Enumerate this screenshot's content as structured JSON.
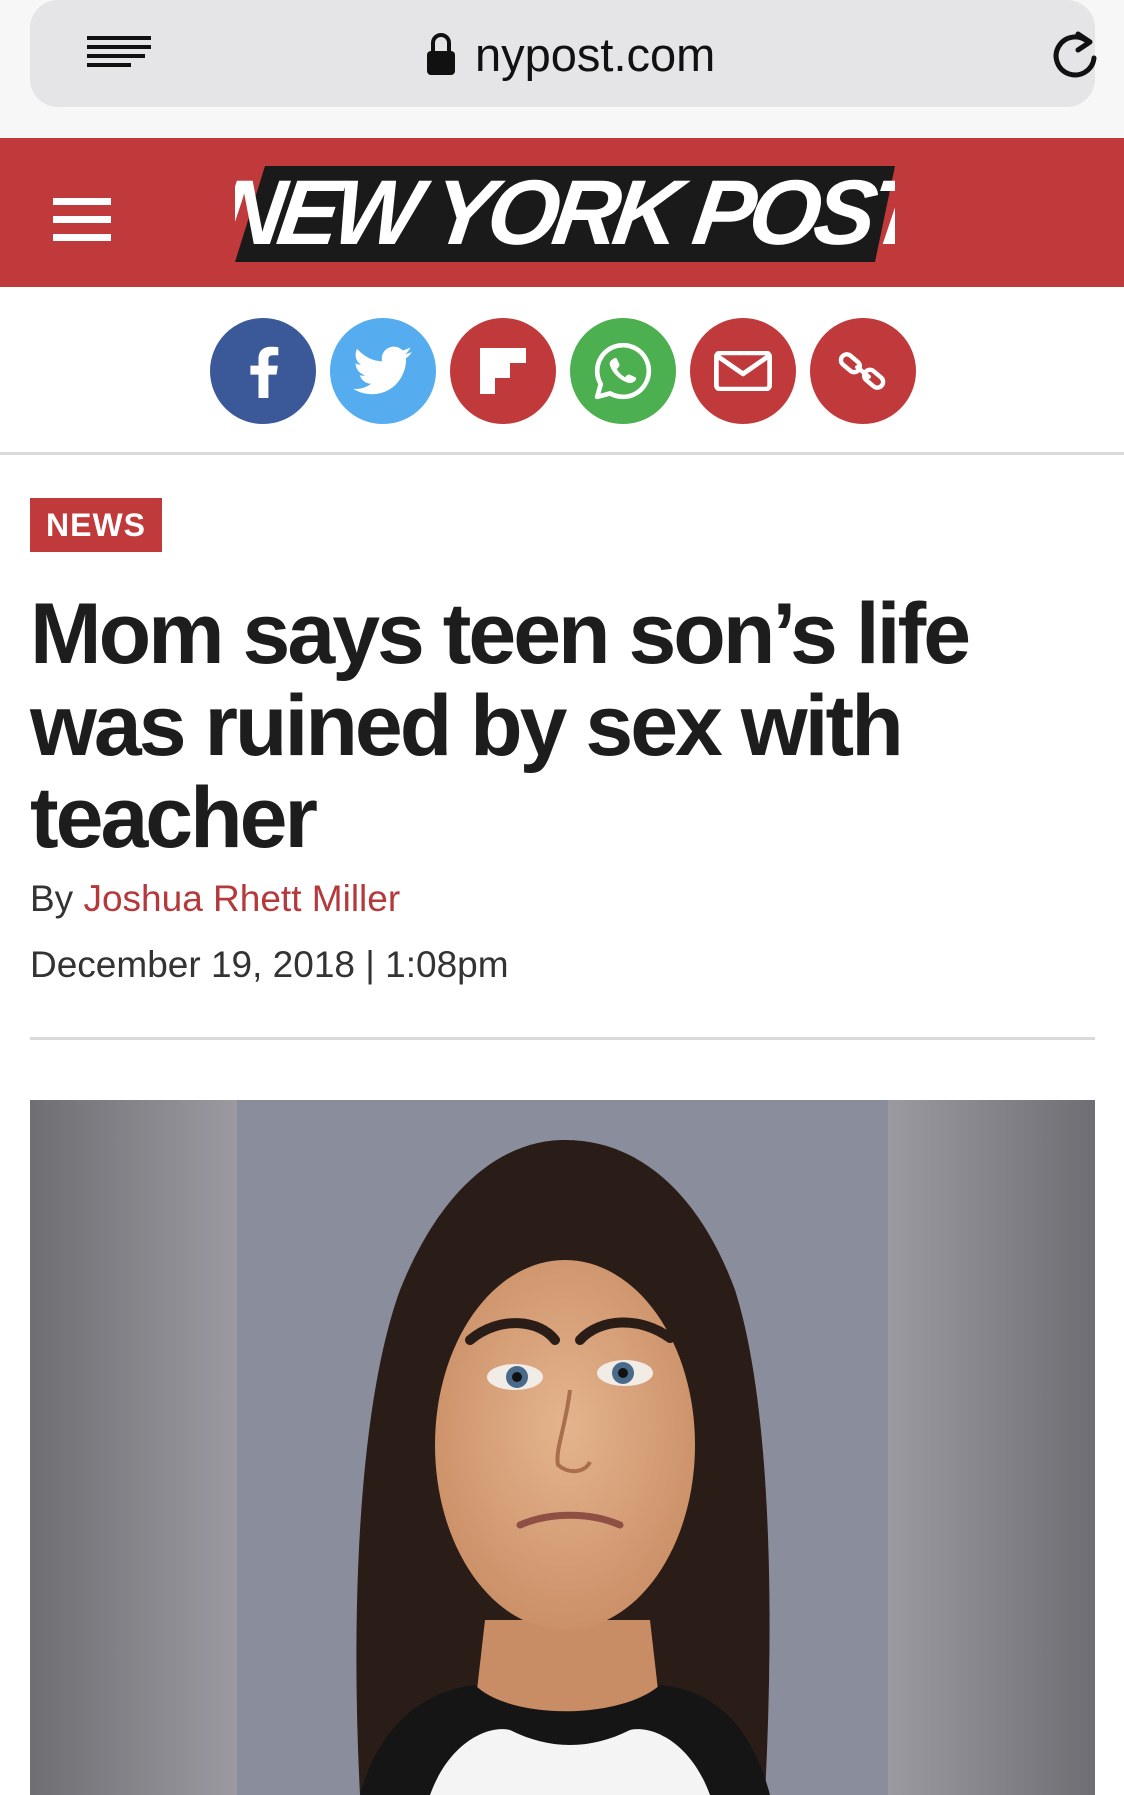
{
  "browser": {
    "url": "nypost.com",
    "reader_icon": "reader-view-icon",
    "lock_icon": "lock-icon",
    "reload_icon": "reload-icon"
  },
  "masthead": {
    "logo_text": "NEW YORK POST",
    "menu_icon": "hamburger-icon",
    "brand_color": "#c0393b"
  },
  "share": {
    "buttons": [
      {
        "name": "facebook",
        "color": "#3b5998"
      },
      {
        "name": "twitter",
        "color": "#55acee"
      },
      {
        "name": "flipboard",
        "color": "#c0393b"
      },
      {
        "name": "whatsapp",
        "color": "#4caf50"
      },
      {
        "name": "email",
        "color": "#c0393b"
      },
      {
        "name": "copy-link",
        "color": "#c0393b"
      }
    ]
  },
  "article": {
    "category": "NEWS",
    "headline": "Mom says teen son’s life was ruined by sex with teacher",
    "byline_prefix": "By ",
    "author": "Joshua Rhett Miller",
    "date": "December 19, 2018 | 1:08pm"
  },
  "photo": {
    "description_icon": "article-photo"
  }
}
